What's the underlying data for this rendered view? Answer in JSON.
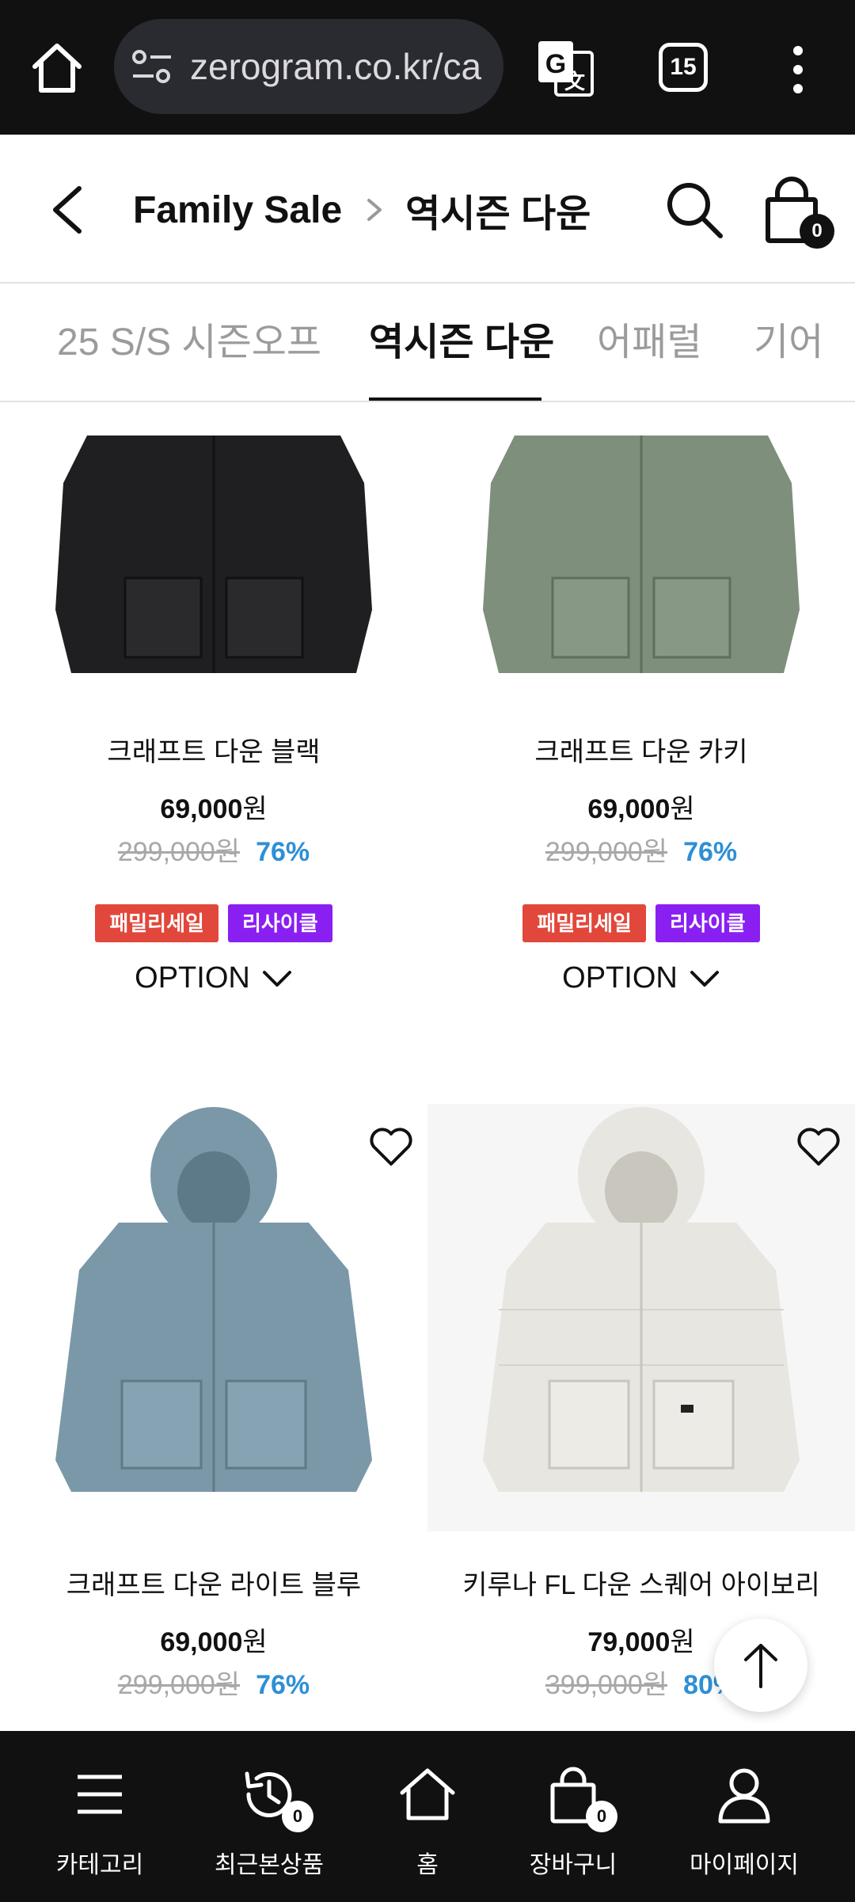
{
  "browser": {
    "url": "zerogram.co.kr/ca",
    "tab_count": "15"
  },
  "header": {
    "crumb_root": "Family Sale",
    "crumb_current": "역시즌 다운",
    "cart_count": "0"
  },
  "category_tabs": [
    {
      "label": "25 S/S 시즌오프"
    },
    {
      "label": "역시즌 다운"
    },
    {
      "label": "어패럴"
    },
    {
      "label": "기어"
    }
  ],
  "products": [
    {
      "name": "크래프트 다운 블랙",
      "price": "69,000",
      "price_unit": "원",
      "original": "299,000원",
      "discount": "76%",
      "tags": [
        "패밀리세일",
        "리사이클"
      ],
      "option_label": "OPTION",
      "color": "#1f1f21"
    },
    {
      "name": "크래프트 다운 카키",
      "price": "69,000",
      "price_unit": "원",
      "original": "299,000원",
      "discount": "76%",
      "tags": [
        "패밀리세일",
        "리사이클"
      ],
      "option_label": "OPTION",
      "color": "#7e8f7c"
    },
    {
      "name": "크래프트 다운 라이트 블루",
      "price": "69,000",
      "price_unit": "원",
      "original": "299,000원",
      "discount": "76%",
      "color": "#7a98a8"
    },
    {
      "name": "키루나 FL 다운 스퀘어 아이보리",
      "price": "79,000",
      "price_unit": "원",
      "original": "399,000원",
      "discount": "80%",
      "color": "#e8e6e0"
    }
  ],
  "bottom_nav": [
    {
      "label": "카테고리",
      "icon": "menu-icon"
    },
    {
      "label": "최근본상품",
      "icon": "history-icon",
      "badge": "0"
    },
    {
      "label": "홈",
      "icon": "home-icon"
    },
    {
      "label": "장바구니",
      "icon": "bag-icon",
      "badge": "0"
    },
    {
      "label": "마이페이지",
      "icon": "user-icon"
    }
  ]
}
